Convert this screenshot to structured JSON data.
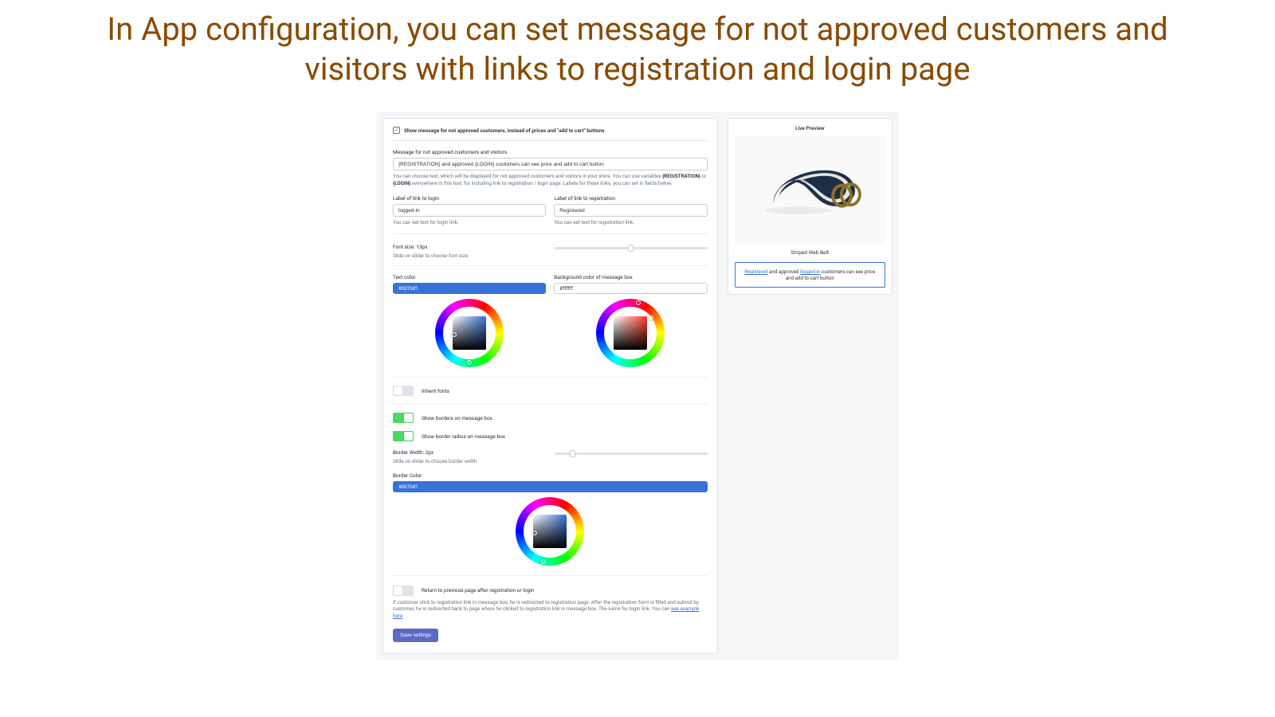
{
  "page": {
    "heading": "In App configuration, you can set message for not approved customers and visitors with links to registration and login page"
  },
  "main": {
    "show_message_checkbox_label": "Show message for not approved customers, instead of prices and \"add to cart\" buttons",
    "message_label": "Message for not approved customers and visitors",
    "message_value": "{REGISTRATION} and approved {LOGIN} customers can see price and add to cart button",
    "message_help_1": "You can choose text, which will be displayed for not approved customers and visitors in your store. You can use variables ",
    "message_help_var1": "{REGISTRATION}",
    "message_help_2": " or ",
    "message_help_var2": "{LOGIN}",
    "message_help_3": " everywhere in this text, for including link to registration / login page. Labels for these links, you can set in fields below.",
    "login_label": "Label of link to login",
    "login_value": "logged-in",
    "login_help": "You can set text for login link.",
    "registration_label": "Label of link to registration",
    "registration_value": "Registered",
    "registration_help": "You can set text for registration link.",
    "font_size_label": "Font size: 13px",
    "font_size_help": "Slide on slider to choose font size.",
    "text_color_label": "Text color",
    "text_color_value": "#0070d1",
    "bg_color_label": "Background color of message box",
    "bg_color_value": "#ffffff",
    "inherit_fonts_label": "Inherit fonts",
    "show_borders_label": "Show borders on message box",
    "show_radius_label": "Show border radius on message box",
    "border_width_label": "Border Width: 2px",
    "border_width_help": "Slide on slider to choose border width",
    "border_color_label": "Border Color:",
    "border_color_value": "#0070d1",
    "return_label": "Return to previous page after registration or login",
    "return_help": "If customer click to registration link in message box, he is redirected to registration page. After the registration form is filled and submit by customer, he is redirected back to page where he clicked to registration link in message box. The same for login link. You can ",
    "return_link": "see example here",
    "save_button": "Save settings"
  },
  "preview": {
    "title": "Live Preview",
    "product_name": "Striped Web Belt",
    "msg_link1": "Registered",
    "msg_mid": " and approved ",
    "msg_link2": "logged-in",
    "msg_tail": " customers can see price and add to cart button"
  }
}
